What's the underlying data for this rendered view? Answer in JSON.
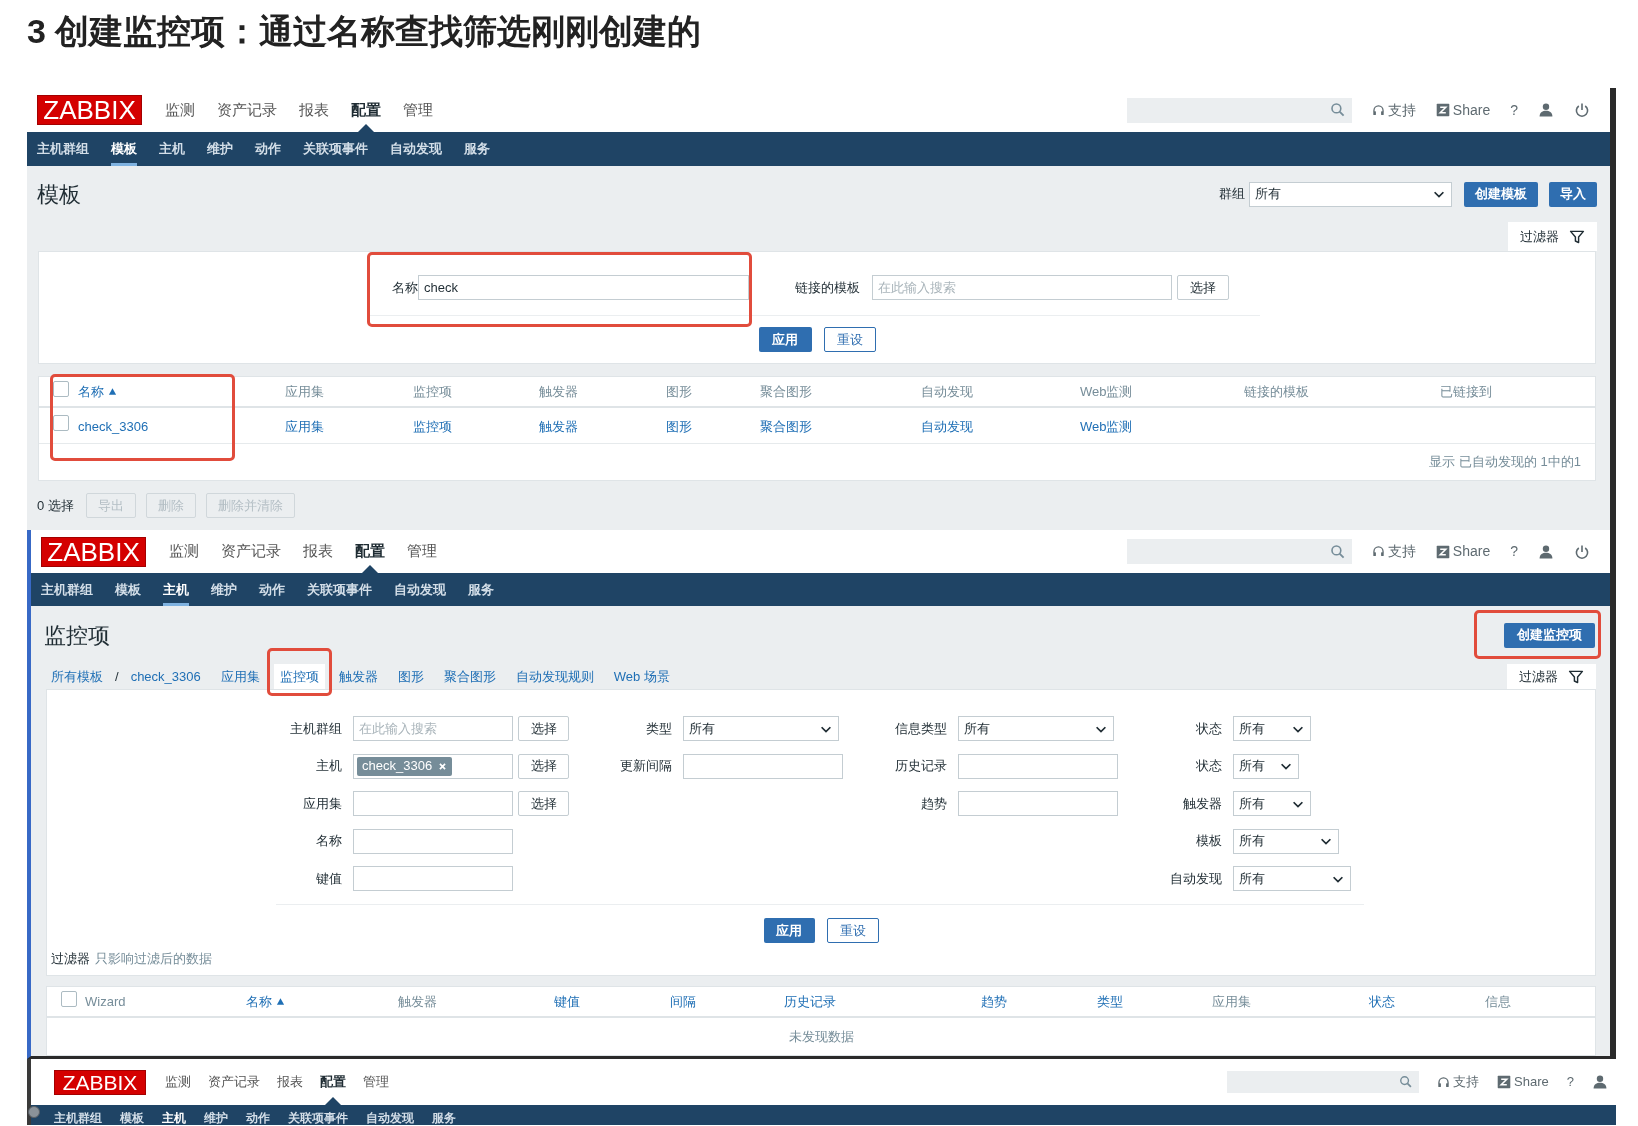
{
  "heading": "3 创建监控项：通过名称查找筛选刚刚创建的",
  "screens": [
    {
      "kind": "templates",
      "header": {
        "logo": "ZABBIX",
        "menu": [
          {
            "label": "监测",
            "selected": false
          },
          {
            "label": "资产记录",
            "selected": false
          },
          {
            "label": "报表",
            "selected": false
          },
          {
            "label": "配置",
            "selected": true
          },
          {
            "label": "管理",
            "selected": false
          }
        ],
        "links": [
          {
            "kind": "support",
            "label": "支持"
          },
          {
            "kind": "share",
            "label": "Share"
          },
          {
            "kind": "help",
            "label": "?"
          }
        ],
        "submenu": [
          {
            "label": "主机群组",
            "selected": false
          },
          {
            "label": "模板",
            "selected": true
          },
          {
            "label": "主机",
            "selected": false
          },
          {
            "label": "维护",
            "selected": false
          },
          {
            "label": "动作",
            "selected": false
          },
          {
            "label": "关联项事件",
            "selected": false
          },
          {
            "label": "自动发现",
            "selected": false
          },
          {
            "label": "服务",
            "selected": false
          }
        ]
      },
      "title": "模板",
      "group": {
        "label": "群组",
        "value": "所有"
      },
      "actions": [
        {
          "label": "创建模板"
        },
        {
          "label": "导入"
        }
      ],
      "filter_tab": "过滤器",
      "filter": {
        "fields": [
          {
            "label": "名称",
            "value": "check",
            "highlighted": true
          },
          {
            "label": "链接的模板",
            "placeholder": "在此输入搜索",
            "button": "选择",
            "highlighted": false
          }
        ],
        "apply": "应用",
        "reset": "重设"
      },
      "table": {
        "checked": false,
        "columns": [
          {
            "label": "名称",
            "sorted": true,
            "highlighted": true
          },
          {
            "label": "应用集"
          },
          {
            "label": "监控项"
          },
          {
            "label": "触发器"
          },
          {
            "label": "图形"
          },
          {
            "label": "聚合图形"
          },
          {
            "label": "自动发现"
          },
          {
            "label": "Web监测"
          },
          {
            "label": "链接的模板"
          },
          {
            "label": "已链接到"
          }
        ],
        "rows": [
          {
            "checked": false,
            "cells": [
              "check_3306",
              "应用集",
              "监控项",
              "触发器",
              "图形",
              "聚合图形",
              "自动发现",
              "Web监测"
            ]
          }
        ],
        "footer": "显示 已自动发现的 1中的1"
      },
      "selection": {
        "count": "0 选择",
        "buttons": [
          {
            "label": "导出",
            "disabled": true
          },
          {
            "label": "删除",
            "disabled": true
          },
          {
            "label": "删除并清除",
            "disabled": true
          }
        ]
      }
    },
    {
      "kind": "items",
      "header": {
        "logo": "ZABBIX",
        "menu": [
          {
            "label": "监测",
            "selected": false
          },
          {
            "label": "资产记录",
            "selected": false
          },
          {
            "label": "报表",
            "selected": false
          },
          {
            "label": "配置",
            "selected": true
          },
          {
            "label": "管理",
            "selected": false
          }
        ],
        "links": [
          {
            "kind": "support",
            "label": "支持"
          },
          {
            "kind": "share",
            "label": "Share"
          },
          {
            "kind": "help",
            "label": "?"
          }
        ],
        "submenu": [
          {
            "label": "主机群组",
            "selected": false
          },
          {
            "label": "模板",
            "selected": false
          },
          {
            "label": "主机",
            "selected": true
          },
          {
            "label": "维护",
            "selected": false
          },
          {
            "label": "动作",
            "selected": false
          },
          {
            "label": "关联项事件",
            "selected": false
          },
          {
            "label": "自动发现",
            "selected": false
          },
          {
            "label": "服务",
            "selected": false
          }
        ]
      },
      "title": "监控项",
      "actions": [
        {
          "label": "创建监控项",
          "highlighted": true
        }
      ],
      "breadcrumb": [
        "所有模板",
        "check_3306"
      ],
      "separator": "/",
      "tabs": [
        {
          "label": "应用集",
          "selected": false,
          "highlighted": false
        },
        {
          "label": "监控项",
          "selected": true,
          "highlighted": true
        },
        {
          "label": "触发器",
          "selected": false,
          "highlighted": false
        },
        {
          "label": "图形",
          "selected": false,
          "highlighted": false
        },
        {
          "label": "聚合图形",
          "selected": false,
          "highlighted": false
        },
        {
          "label": "自动发现规则",
          "selected": false,
          "highlighted": false
        },
        {
          "label": "Web 场景",
          "selected": false,
          "highlighted": false
        }
      ],
      "filter_tab": "过滤器",
      "filter": {
        "columns": [
          [
            {
              "kind": "text",
              "label": "主机群组",
              "placeholder": "在此输入搜索",
              "button": "选择"
            },
            {
              "kind": "tags",
              "label": "主机",
              "tags": [
                "check_3306"
              ],
              "button": "选择"
            },
            {
              "kind": "text",
              "label": "应用集",
              "button": "选择"
            },
            {
              "kind": "text",
              "label": "名称"
            },
            {
              "kind": "text",
              "label": "键值"
            }
          ],
          [
            {
              "kind": "select",
              "label": "类型",
              "value": "所有"
            },
            {
              "kind": "text",
              "label": "更新间隔"
            }
          ],
          [
            {
              "kind": "select",
              "label": "信息类型",
              "value": "所有"
            },
            {
              "kind": "text",
              "label": "历史记录"
            },
            {
              "kind": "text",
              "label": "趋势"
            }
          ],
          [
            {
              "kind": "select",
              "label": "状态",
              "value": "所有"
            },
            {
              "kind": "select",
              "label": "状态",
              "value": "所有"
            },
            {
              "kind": "select",
              "label": "触发器",
              "value": "所有"
            },
            {
              "kind": "select",
              "label": "模板",
              "value": "所有"
            },
            {
              "kind": "select",
              "label": "自动发现",
              "value": "所有"
            }
          ]
        ],
        "apply": "应用",
        "reset": "重设"
      },
      "subfilter": {
        "label": "过滤器",
        "note": "只影响过滤后的数据"
      },
      "table": {
        "checked": false,
        "columns": [
          {
            "label": "Wizard",
            "sortable": false
          },
          {
            "label": "名称",
            "sortable": true,
            "sorted": true
          },
          {
            "label": "触发器",
            "sortable": false
          },
          {
            "label": "键值",
            "sortable": true
          },
          {
            "label": "间隔",
            "sortable": true
          },
          {
            "label": "历史记录",
            "sortable": true
          },
          {
            "label": "趋势",
            "sortable": true
          },
          {
            "label": "类型",
            "sortable": true
          },
          {
            "label": "应用集",
            "sortable": false
          },
          {
            "label": "状态",
            "sortable": true
          },
          {
            "label": "信息",
            "sortable": false
          }
        ],
        "empty": "未发现数据"
      }
    },
    {
      "kind": "header_only",
      "header": {
        "logo": "ZABBIX",
        "clipped": true,
        "menu": [
          {
            "label": "监测",
            "selected": false
          },
          {
            "label": "资产记录",
            "selected": false
          },
          {
            "label": "报表",
            "selected": false
          },
          {
            "label": "配置",
            "selected": true
          },
          {
            "label": "管理",
            "selected": false
          }
        ],
        "links": [
          {
            "kind": "support",
            "label": "支持"
          },
          {
            "kind": "share",
            "label": "Share"
          },
          {
            "kind": "help",
            "label": "?"
          }
        ],
        "submenu": [
          {
            "label": "主机群组",
            "selected": false
          },
          {
            "label": "模板",
            "selected": false
          },
          {
            "label": "主机",
            "selected": true
          },
          {
            "label": "维护",
            "selected": false
          },
          {
            "label": "动作",
            "selected": false
          },
          {
            "label": "关联项事件",
            "selected": false
          },
          {
            "label": "自动发现",
            "selected": false
          },
          {
            "label": "服务",
            "selected": false
          }
        ]
      }
    }
  ]
}
